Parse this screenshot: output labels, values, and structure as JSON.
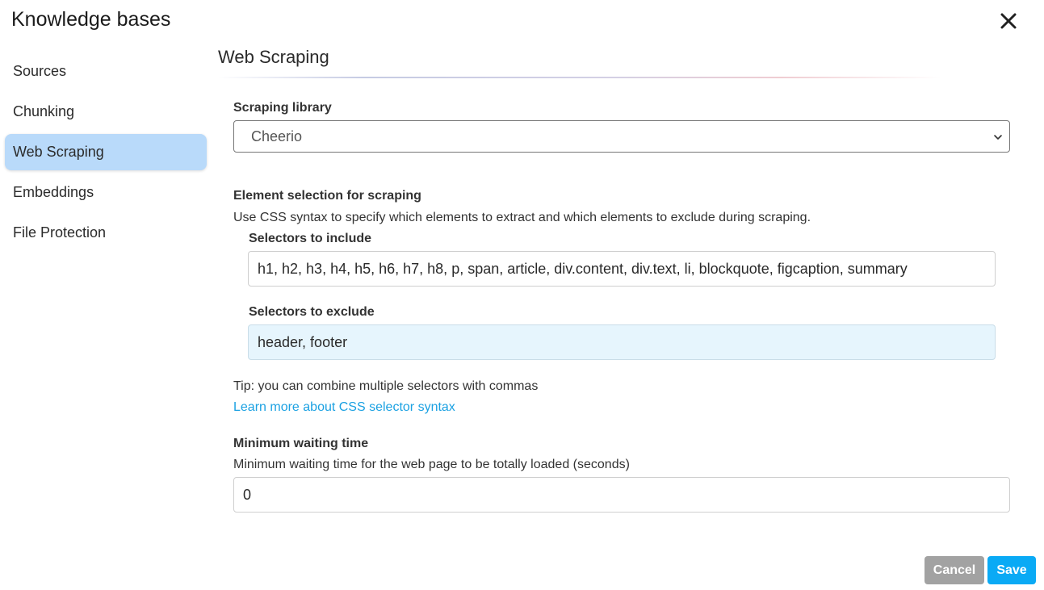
{
  "dialog": {
    "title": "Knowledge bases"
  },
  "sidebar": {
    "items": [
      {
        "label": "Sources",
        "active": false
      },
      {
        "label": "Chunking",
        "active": false
      },
      {
        "label": "Web Scraping",
        "active": true
      },
      {
        "label": "Embeddings",
        "active": false
      },
      {
        "label": "File Protection",
        "active": false
      }
    ]
  },
  "main": {
    "title": "Web Scraping",
    "library": {
      "label": "Scraping library",
      "selected": "Cheerio"
    },
    "element_selection": {
      "label": "Element selection for scraping",
      "description": "Use CSS syntax to specify which elements to extract and which elements to exclude during scraping.",
      "include": {
        "label": "Selectors to include",
        "value": "h1, h2, h3, h4, h5, h6, h7, h8, p, span, article, div.content, div.text, li, blockquote, figcaption, summary"
      },
      "exclude": {
        "label": "Selectors to exclude",
        "value": "header, footer"
      },
      "tip": "Tip: you can combine multiple selectors with commas",
      "link": "Learn more about CSS selector syntax"
    },
    "waiting": {
      "label": "Minimum waiting time",
      "description": "Minimum waiting time for the web page to be totally loaded (seconds)",
      "value": "0"
    }
  },
  "footer": {
    "cancel_label": "Cancel",
    "save_label": "Save"
  },
  "colors": {
    "accent": "#0aaaf5",
    "active_nav": "#b9dafa",
    "link": "#1ba1e2",
    "cancel": "#a2a2a2"
  }
}
